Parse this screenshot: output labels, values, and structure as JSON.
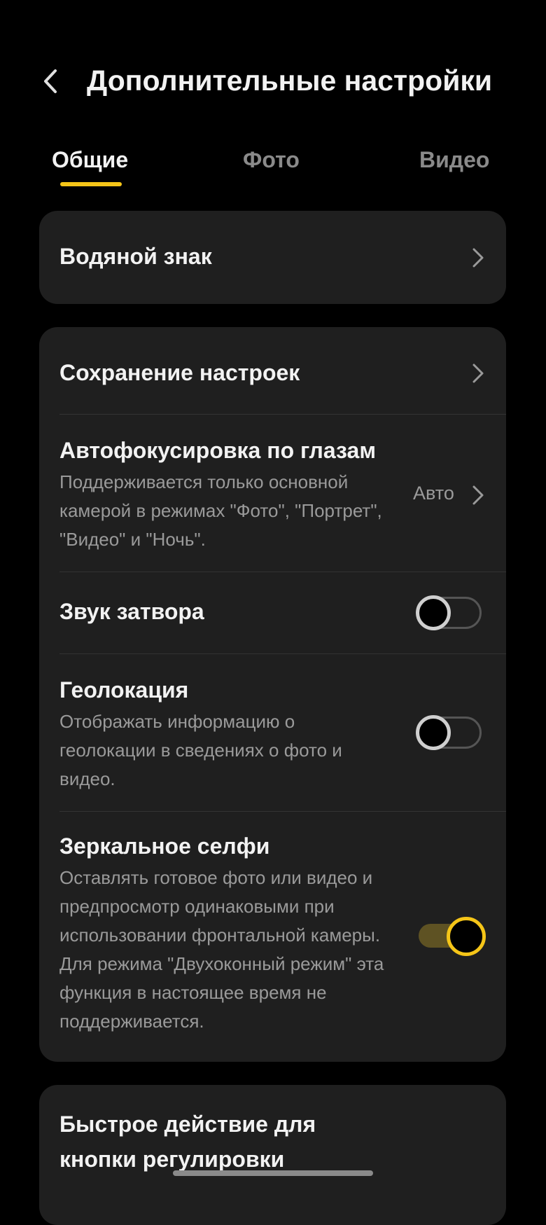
{
  "header": {
    "title": "Дополнительные настройки",
    "back_icon": "chevron-left-icon"
  },
  "tabs": [
    {
      "label": "Общие",
      "active": true
    },
    {
      "label": "Фото",
      "active": false
    },
    {
      "label": "Видео",
      "active": false
    }
  ],
  "accent_color": "#f5c518",
  "settings": {
    "watermark": {
      "title": "Водяной знак"
    },
    "save_settings": {
      "title": "Сохранение настроек"
    },
    "eye_autofocus": {
      "title": "Автофокусировка по глазам",
      "description": "Поддерживается только основной камерой в режимах \"Фото\", \"Портрет\", \"Видео\" и \"Ночь\".",
      "value": "Авто"
    },
    "shutter_sound": {
      "title": "Звук затвора",
      "enabled": false
    },
    "geolocation": {
      "title": "Геолокация",
      "description": "Отображать информацию о геолокации в сведениях о фото и видео.",
      "enabled": false
    },
    "mirror_selfie": {
      "title": "Зеркальное селфи",
      "description": "Оставлять готовое фото или видео и предпросмотр одинаковыми при использовании фронтальной камеры. Для режима \"Двухоконный режим\" эта функция в настоящее время не поддерживается.",
      "enabled": true
    },
    "quick_action": {
      "title_line1": "Быстрое действие для",
      "title_line2": "кнопки регулировки"
    }
  }
}
